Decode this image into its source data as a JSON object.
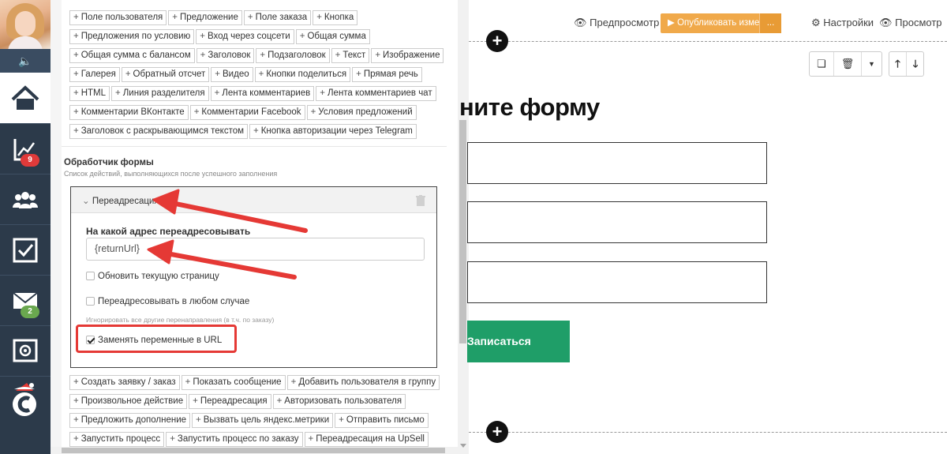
{
  "sidebar": {
    "badges": {
      "stats": "9",
      "mail": "2"
    }
  },
  "top_buttons": [
    [
      "Поле пользователя",
      "Предложение",
      "Поле заказа",
      "Кнопка"
    ],
    [
      "Предложения по условию",
      "Вход через соцсети",
      "Общая сумма"
    ],
    [
      "Общая сумма с балансом",
      "Заголовок",
      "Подзаголовок",
      "Текст",
      "Изображение"
    ],
    [
      "Галерея",
      "Обратный отсчет",
      "Видео",
      "Кнопки поделиться",
      "Прямая речь"
    ],
    [
      "HTML",
      "Линия разделителя",
      "Лента комментариев",
      "Лента комментариев чат"
    ],
    [
      "Комментарии ВКонтакте",
      "Комментарии Facebook",
      "Условия предложений"
    ],
    [
      "Заголовок с раскрывающимся текстом",
      "Кнопка авторизации через Telegram"
    ]
  ],
  "handler": {
    "title": "Обработчик формы",
    "subtitle": "Список действий, выполняющихся после успешного заполнения",
    "card": {
      "title": "Переадресация",
      "field_label": "На какой адрес переадресовывать",
      "url_value": "{returnUrl}",
      "checkbox_refresh": "Обновить текущую страницу",
      "checkbox_always": "Переадресовывать в любом случае",
      "note": "Игнорировать все другие перенаправления (в т.ч. по заказу)",
      "checkbox_replace": "Заменять переменные в URL"
    }
  },
  "action_buttons": [
    [
      "Создать заявку / заказ",
      "Показать сообщение",
      "Добавить пользователя в группу"
    ],
    [
      "Произвольное действие",
      "Переадресация",
      "Авторизовать пользователя"
    ],
    [
      "Предложить дополнение",
      "Вызвать цель яндекс.метрики",
      "Отправить письмо"
    ],
    [
      "Запустить процесс",
      "Запустить процесс по заказу",
      "Переадресация на UpSell"
    ]
  ],
  "toolbar": {
    "preview": "Предпросмотр",
    "publish": "Опубликовать изменения",
    "settings": "Настройки",
    "view": "Просмотр"
  },
  "form": {
    "title": "ните форму",
    "submit": "Записаться"
  },
  "colors": {
    "sidebar": "#2c3a4a",
    "publish": "#f0a94a",
    "submit": "#1f9e68",
    "highlight": "#e53935"
  }
}
